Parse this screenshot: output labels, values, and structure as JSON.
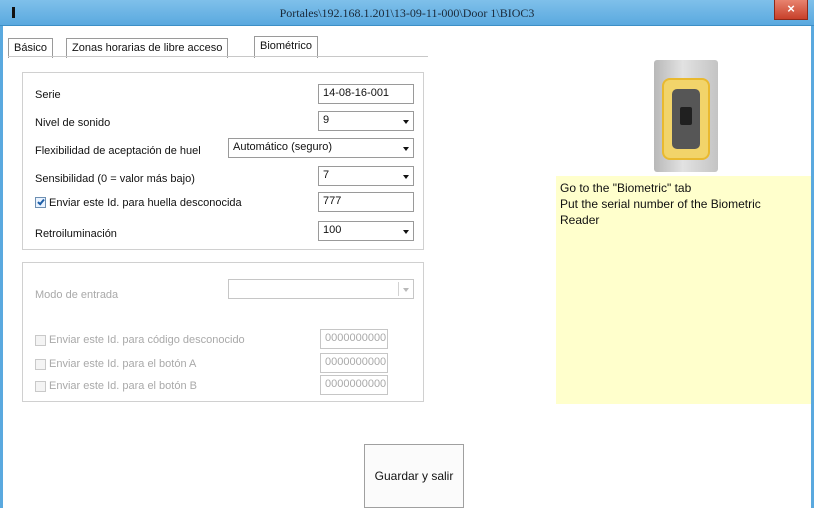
{
  "window": {
    "title": "Portales\\192.168.1.201\\13-09-11-000\\Door 1\\BIOC3",
    "close_glyph": "×"
  },
  "tabs": [
    {
      "label": "Básico",
      "active": false
    },
    {
      "label": "Zonas horarias de libre acceso",
      "active": false
    },
    {
      "label": "Biométrico",
      "active": true
    }
  ],
  "biometric": {
    "serie": {
      "label": "Serie",
      "value": "14-08-16-001"
    },
    "nivel_sonido": {
      "label": "Nivel de sonido",
      "value": "9"
    },
    "flexibilidad": {
      "label": "Flexibilidad de aceptación de huel",
      "value": "Automático (seguro)"
    },
    "sensibilidad": {
      "label": "Sensibilidad (0 = valor más bajo)",
      "value": "7"
    },
    "enviar_id_huella": {
      "label": "Enviar este Id. para huella desconocida",
      "checked": true,
      "value": "777"
    },
    "retroiluminacion": {
      "label": "Retroiluminación",
      "value": "100"
    }
  },
  "entry": {
    "modo_entrada": {
      "label": "Modo de entrada",
      "value": ""
    },
    "rows": [
      {
        "label": "Enviar este Id. para código desconocido",
        "checked": false,
        "value": "0000000000"
      },
      {
        "label": "Enviar este Id. para el botón A",
        "checked": false,
        "value": "0000000000"
      },
      {
        "label": "Enviar este Id. para el botón B",
        "checked": false,
        "value": "0000000000"
      }
    ]
  },
  "save_button": {
    "label": "Guardar y salir"
  },
  "note": {
    "lines": [
      "Go to the \"Biometric\" tab",
      "Put the serial number of the Biometric",
      "Reader"
    ]
  },
  "colors": {
    "titlebar": "#5aa9df",
    "close": "#c7402a",
    "note_bg": "#ffffcc",
    "device_ring": "#e9b92f"
  }
}
